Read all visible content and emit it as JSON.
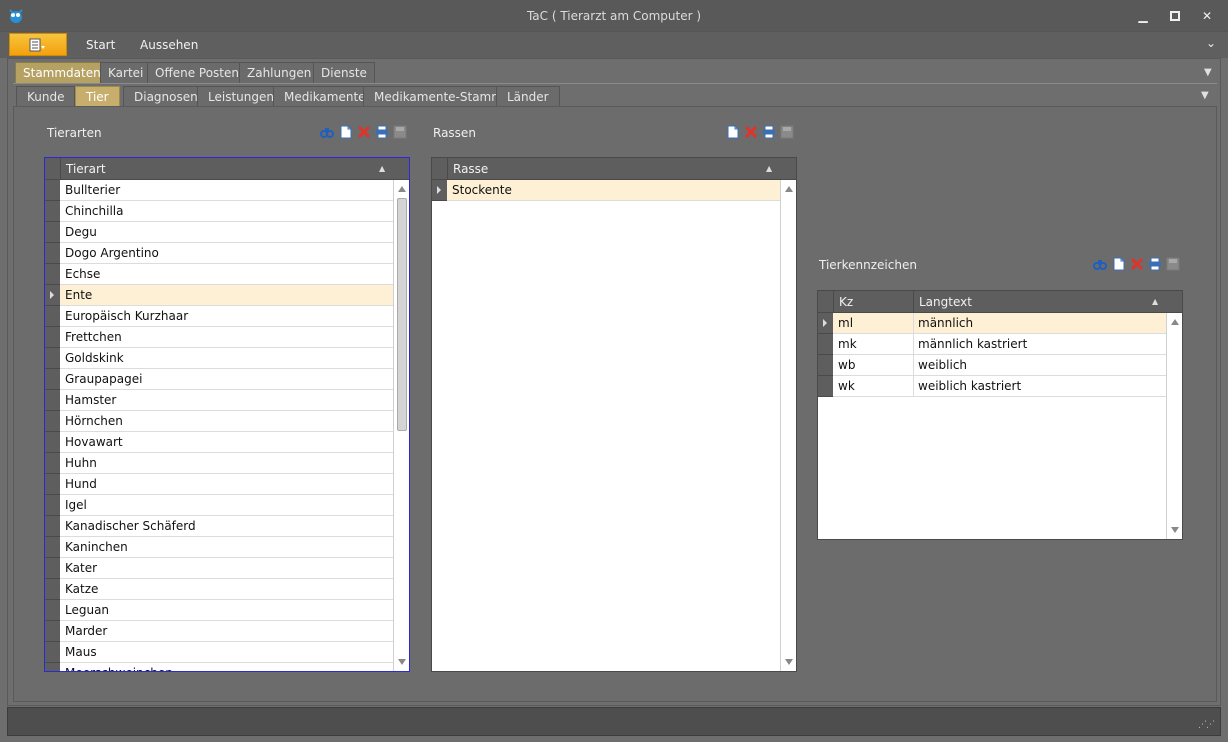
{
  "window": {
    "title": "TaC ( Tierarzt am Computer )",
    "controls": [
      "minimize-icon",
      "maximize-icon",
      "close-icon"
    ]
  },
  "ribbon": {
    "tabs": [
      {
        "label": "Start"
      },
      {
        "label": "Aussehen"
      }
    ]
  },
  "tabs_main": [
    {
      "label": "Stammdaten",
      "active": true
    },
    {
      "label": "Kartei"
    },
    {
      "label": "Offene Posten"
    },
    {
      "label": "Zahlungen"
    },
    {
      "label": "Dienste"
    }
  ],
  "tabs_sub": [
    {
      "label": "Kunde"
    },
    {
      "label": "Tier",
      "active": true
    },
    {
      "label": "Diagnosen"
    },
    {
      "label": "Leistungen"
    },
    {
      "label": "Medikamente"
    },
    {
      "label": "Medikamente-Stamm"
    },
    {
      "label": "Länder"
    }
  ],
  "tierarten": {
    "label": "Tierarten",
    "column": "Tierart",
    "selected_index": 5,
    "rows": [
      "Bullterier",
      "Chinchilla",
      "Degu",
      "Dogo Argentino",
      "Echse",
      "Ente",
      "Europäisch Kurzhaar",
      "Frettchen",
      "Goldskink",
      "Graupapagei",
      "Hamster",
      "Hörnchen",
      "Hovawart",
      "Huhn",
      "Hund",
      "Igel",
      "Kanadischer Schäferd",
      "Kaninchen",
      "Kater",
      "Katze",
      "Leguan",
      "Marder",
      "Maus",
      "Meerschweinchen"
    ],
    "toolbar": [
      "binoculars-icon",
      "new-document-icon",
      "delete-icon",
      "print-icon",
      "save-icon"
    ]
  },
  "rassen": {
    "label": "Rassen",
    "column": "Rasse",
    "selected_index": 0,
    "rows": [
      "Stockente"
    ],
    "toolbar": [
      "new-document-icon",
      "delete-icon",
      "print-icon",
      "save-icon"
    ]
  },
  "tierkennzeichen": {
    "label": "Tierkennzeichen",
    "columns": [
      "Kz",
      "Langtext"
    ],
    "selected_index": 0,
    "rows": [
      {
        "kz": "ml",
        "langtext": "männlich"
      },
      {
        "kz": "mk",
        "langtext": "männlich kastriert"
      },
      {
        "kz": "wb",
        "langtext": "weiblich"
      },
      {
        "kz": "wk",
        "langtext": "weiblich kastriert"
      }
    ],
    "toolbar": [
      "binoculars-icon",
      "new-document-icon",
      "delete-icon",
      "print-icon",
      "save-icon"
    ]
  },
  "colors": {
    "accent_orange": "#f3a10e",
    "active_tab": "#b5a263",
    "selected_row": "#fdf0d4",
    "focus_border": "#2a2adb"
  }
}
